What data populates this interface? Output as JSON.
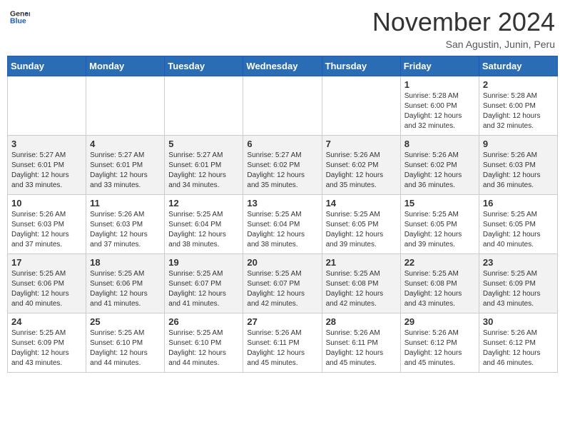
{
  "header": {
    "logo_line1": "General",
    "logo_line2": "Blue",
    "month": "November 2024",
    "location": "San Agustin, Junin, Peru"
  },
  "weekdays": [
    "Sunday",
    "Monday",
    "Tuesday",
    "Wednesday",
    "Thursday",
    "Friday",
    "Saturday"
  ],
  "weeks": [
    [
      {
        "day": "",
        "info": ""
      },
      {
        "day": "",
        "info": ""
      },
      {
        "day": "",
        "info": ""
      },
      {
        "day": "",
        "info": ""
      },
      {
        "day": "",
        "info": ""
      },
      {
        "day": "1",
        "info": "Sunrise: 5:28 AM\nSunset: 6:00 PM\nDaylight: 12 hours\nand 32 minutes."
      },
      {
        "day": "2",
        "info": "Sunrise: 5:28 AM\nSunset: 6:00 PM\nDaylight: 12 hours\nand 32 minutes."
      }
    ],
    [
      {
        "day": "3",
        "info": "Sunrise: 5:27 AM\nSunset: 6:01 PM\nDaylight: 12 hours\nand 33 minutes."
      },
      {
        "day": "4",
        "info": "Sunrise: 5:27 AM\nSunset: 6:01 PM\nDaylight: 12 hours\nand 33 minutes."
      },
      {
        "day": "5",
        "info": "Sunrise: 5:27 AM\nSunset: 6:01 PM\nDaylight: 12 hours\nand 34 minutes."
      },
      {
        "day": "6",
        "info": "Sunrise: 5:27 AM\nSunset: 6:02 PM\nDaylight: 12 hours\nand 35 minutes."
      },
      {
        "day": "7",
        "info": "Sunrise: 5:26 AM\nSunset: 6:02 PM\nDaylight: 12 hours\nand 35 minutes."
      },
      {
        "day": "8",
        "info": "Sunrise: 5:26 AM\nSunset: 6:02 PM\nDaylight: 12 hours\nand 36 minutes."
      },
      {
        "day": "9",
        "info": "Sunrise: 5:26 AM\nSunset: 6:03 PM\nDaylight: 12 hours\nand 36 minutes."
      }
    ],
    [
      {
        "day": "10",
        "info": "Sunrise: 5:26 AM\nSunset: 6:03 PM\nDaylight: 12 hours\nand 37 minutes."
      },
      {
        "day": "11",
        "info": "Sunrise: 5:26 AM\nSunset: 6:03 PM\nDaylight: 12 hours\nand 37 minutes."
      },
      {
        "day": "12",
        "info": "Sunrise: 5:25 AM\nSunset: 6:04 PM\nDaylight: 12 hours\nand 38 minutes."
      },
      {
        "day": "13",
        "info": "Sunrise: 5:25 AM\nSunset: 6:04 PM\nDaylight: 12 hours\nand 38 minutes."
      },
      {
        "day": "14",
        "info": "Sunrise: 5:25 AM\nSunset: 6:05 PM\nDaylight: 12 hours\nand 39 minutes."
      },
      {
        "day": "15",
        "info": "Sunrise: 5:25 AM\nSunset: 6:05 PM\nDaylight: 12 hours\nand 39 minutes."
      },
      {
        "day": "16",
        "info": "Sunrise: 5:25 AM\nSunset: 6:05 PM\nDaylight: 12 hours\nand 40 minutes."
      }
    ],
    [
      {
        "day": "17",
        "info": "Sunrise: 5:25 AM\nSunset: 6:06 PM\nDaylight: 12 hours\nand 40 minutes."
      },
      {
        "day": "18",
        "info": "Sunrise: 5:25 AM\nSunset: 6:06 PM\nDaylight: 12 hours\nand 41 minutes."
      },
      {
        "day": "19",
        "info": "Sunrise: 5:25 AM\nSunset: 6:07 PM\nDaylight: 12 hours\nand 41 minutes."
      },
      {
        "day": "20",
        "info": "Sunrise: 5:25 AM\nSunset: 6:07 PM\nDaylight: 12 hours\nand 42 minutes."
      },
      {
        "day": "21",
        "info": "Sunrise: 5:25 AM\nSunset: 6:08 PM\nDaylight: 12 hours\nand 42 minutes."
      },
      {
        "day": "22",
        "info": "Sunrise: 5:25 AM\nSunset: 6:08 PM\nDaylight: 12 hours\nand 43 minutes."
      },
      {
        "day": "23",
        "info": "Sunrise: 5:25 AM\nSunset: 6:09 PM\nDaylight: 12 hours\nand 43 minutes."
      }
    ],
    [
      {
        "day": "24",
        "info": "Sunrise: 5:25 AM\nSunset: 6:09 PM\nDaylight: 12 hours\nand 43 minutes."
      },
      {
        "day": "25",
        "info": "Sunrise: 5:25 AM\nSunset: 6:10 PM\nDaylight: 12 hours\nand 44 minutes."
      },
      {
        "day": "26",
        "info": "Sunrise: 5:25 AM\nSunset: 6:10 PM\nDaylight: 12 hours\nand 44 minutes."
      },
      {
        "day": "27",
        "info": "Sunrise: 5:26 AM\nSunset: 6:11 PM\nDaylight: 12 hours\nand 45 minutes."
      },
      {
        "day": "28",
        "info": "Sunrise: 5:26 AM\nSunset: 6:11 PM\nDaylight: 12 hours\nand 45 minutes."
      },
      {
        "day": "29",
        "info": "Sunrise: 5:26 AM\nSunset: 6:12 PM\nDaylight: 12 hours\nand 45 minutes."
      },
      {
        "day": "30",
        "info": "Sunrise: 5:26 AM\nSunset: 6:12 PM\nDaylight: 12 hours\nand 46 minutes."
      }
    ]
  ]
}
